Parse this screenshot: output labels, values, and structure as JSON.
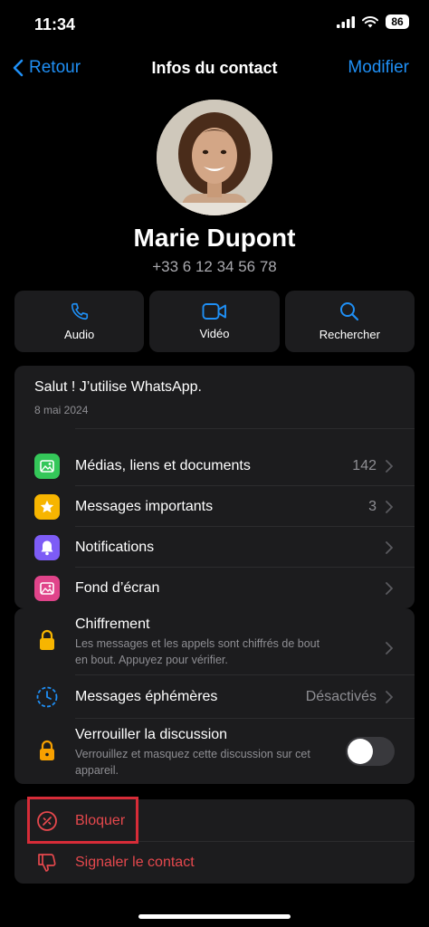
{
  "status_bar": {
    "time": "11:34",
    "battery": "86"
  },
  "nav": {
    "back_label": "Retour",
    "title": "Infos du contact",
    "edit_label": "Modifier"
  },
  "contact": {
    "name": "Marie Dupont",
    "phone": "+33 6 12 34 56 78"
  },
  "actions": [
    {
      "label": "Audio",
      "icon": "phone-icon"
    },
    {
      "label": "Vidéo",
      "icon": "video-icon"
    },
    {
      "label": "Rechercher",
      "icon": "search-icon"
    }
  ],
  "about": {
    "text": "Salut ! J’utilise WhatsApp.",
    "date": "8 mai 2024"
  },
  "menu_primary": [
    {
      "label": "Médias, liens et documents",
      "value": "142",
      "icon": "photo-icon",
      "color": "#34c759"
    },
    {
      "label": "Messages importants",
      "value": "3",
      "icon": "star-icon",
      "color": "#f7b500"
    },
    {
      "label": "Notifications",
      "value": "",
      "icon": "bell-icon",
      "color": "#7d5cf6"
    },
    {
      "label": "Fond d’écran",
      "value": "",
      "icon": "wallpaper-icon",
      "color": "#e0448a"
    }
  ],
  "privacy": {
    "encryption": {
      "title": "Chiffrement",
      "subtitle": "Les messages et les appels sont chiffrés de bout en bout. Appuyez pour vérifier."
    },
    "ephemeral": {
      "title": "Messages éphémères",
      "value": "Désactivés"
    },
    "lock": {
      "title": "Verrouiller la discussion",
      "subtitle": "Verrouillez et masquez cette discussion sur cet appareil.",
      "enabled": false
    }
  },
  "danger": {
    "block_label": "Bloquer",
    "report_label": "Signaler le contact"
  },
  "colors": {
    "accent": "#1f8ff5",
    "danger": "#e5484d",
    "highlight": "#d72c38"
  }
}
